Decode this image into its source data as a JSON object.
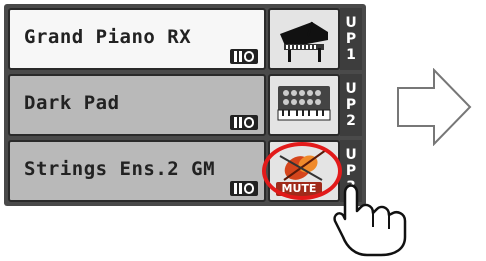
{
  "parts": [
    {
      "name": "Grand Piano RX",
      "label": [
        "U",
        "P",
        "1"
      ],
      "icon": "grand-piano-icon",
      "selected": true
    },
    {
      "name": "Dark Pad",
      "label": [
        "U",
        "P",
        "2"
      ],
      "icon": "keyboard-pad-icon",
      "selected": false
    },
    {
      "name": "Strings Ens.2 GM",
      "label": [
        "U",
        "P",
        "3"
      ],
      "icon": "strings-violin-icon",
      "selected": false,
      "mute": "MUTE"
    }
  ],
  "colors": {
    "highlight_ring": "#e21a1a",
    "mute_badge": "#a02a1a"
  }
}
